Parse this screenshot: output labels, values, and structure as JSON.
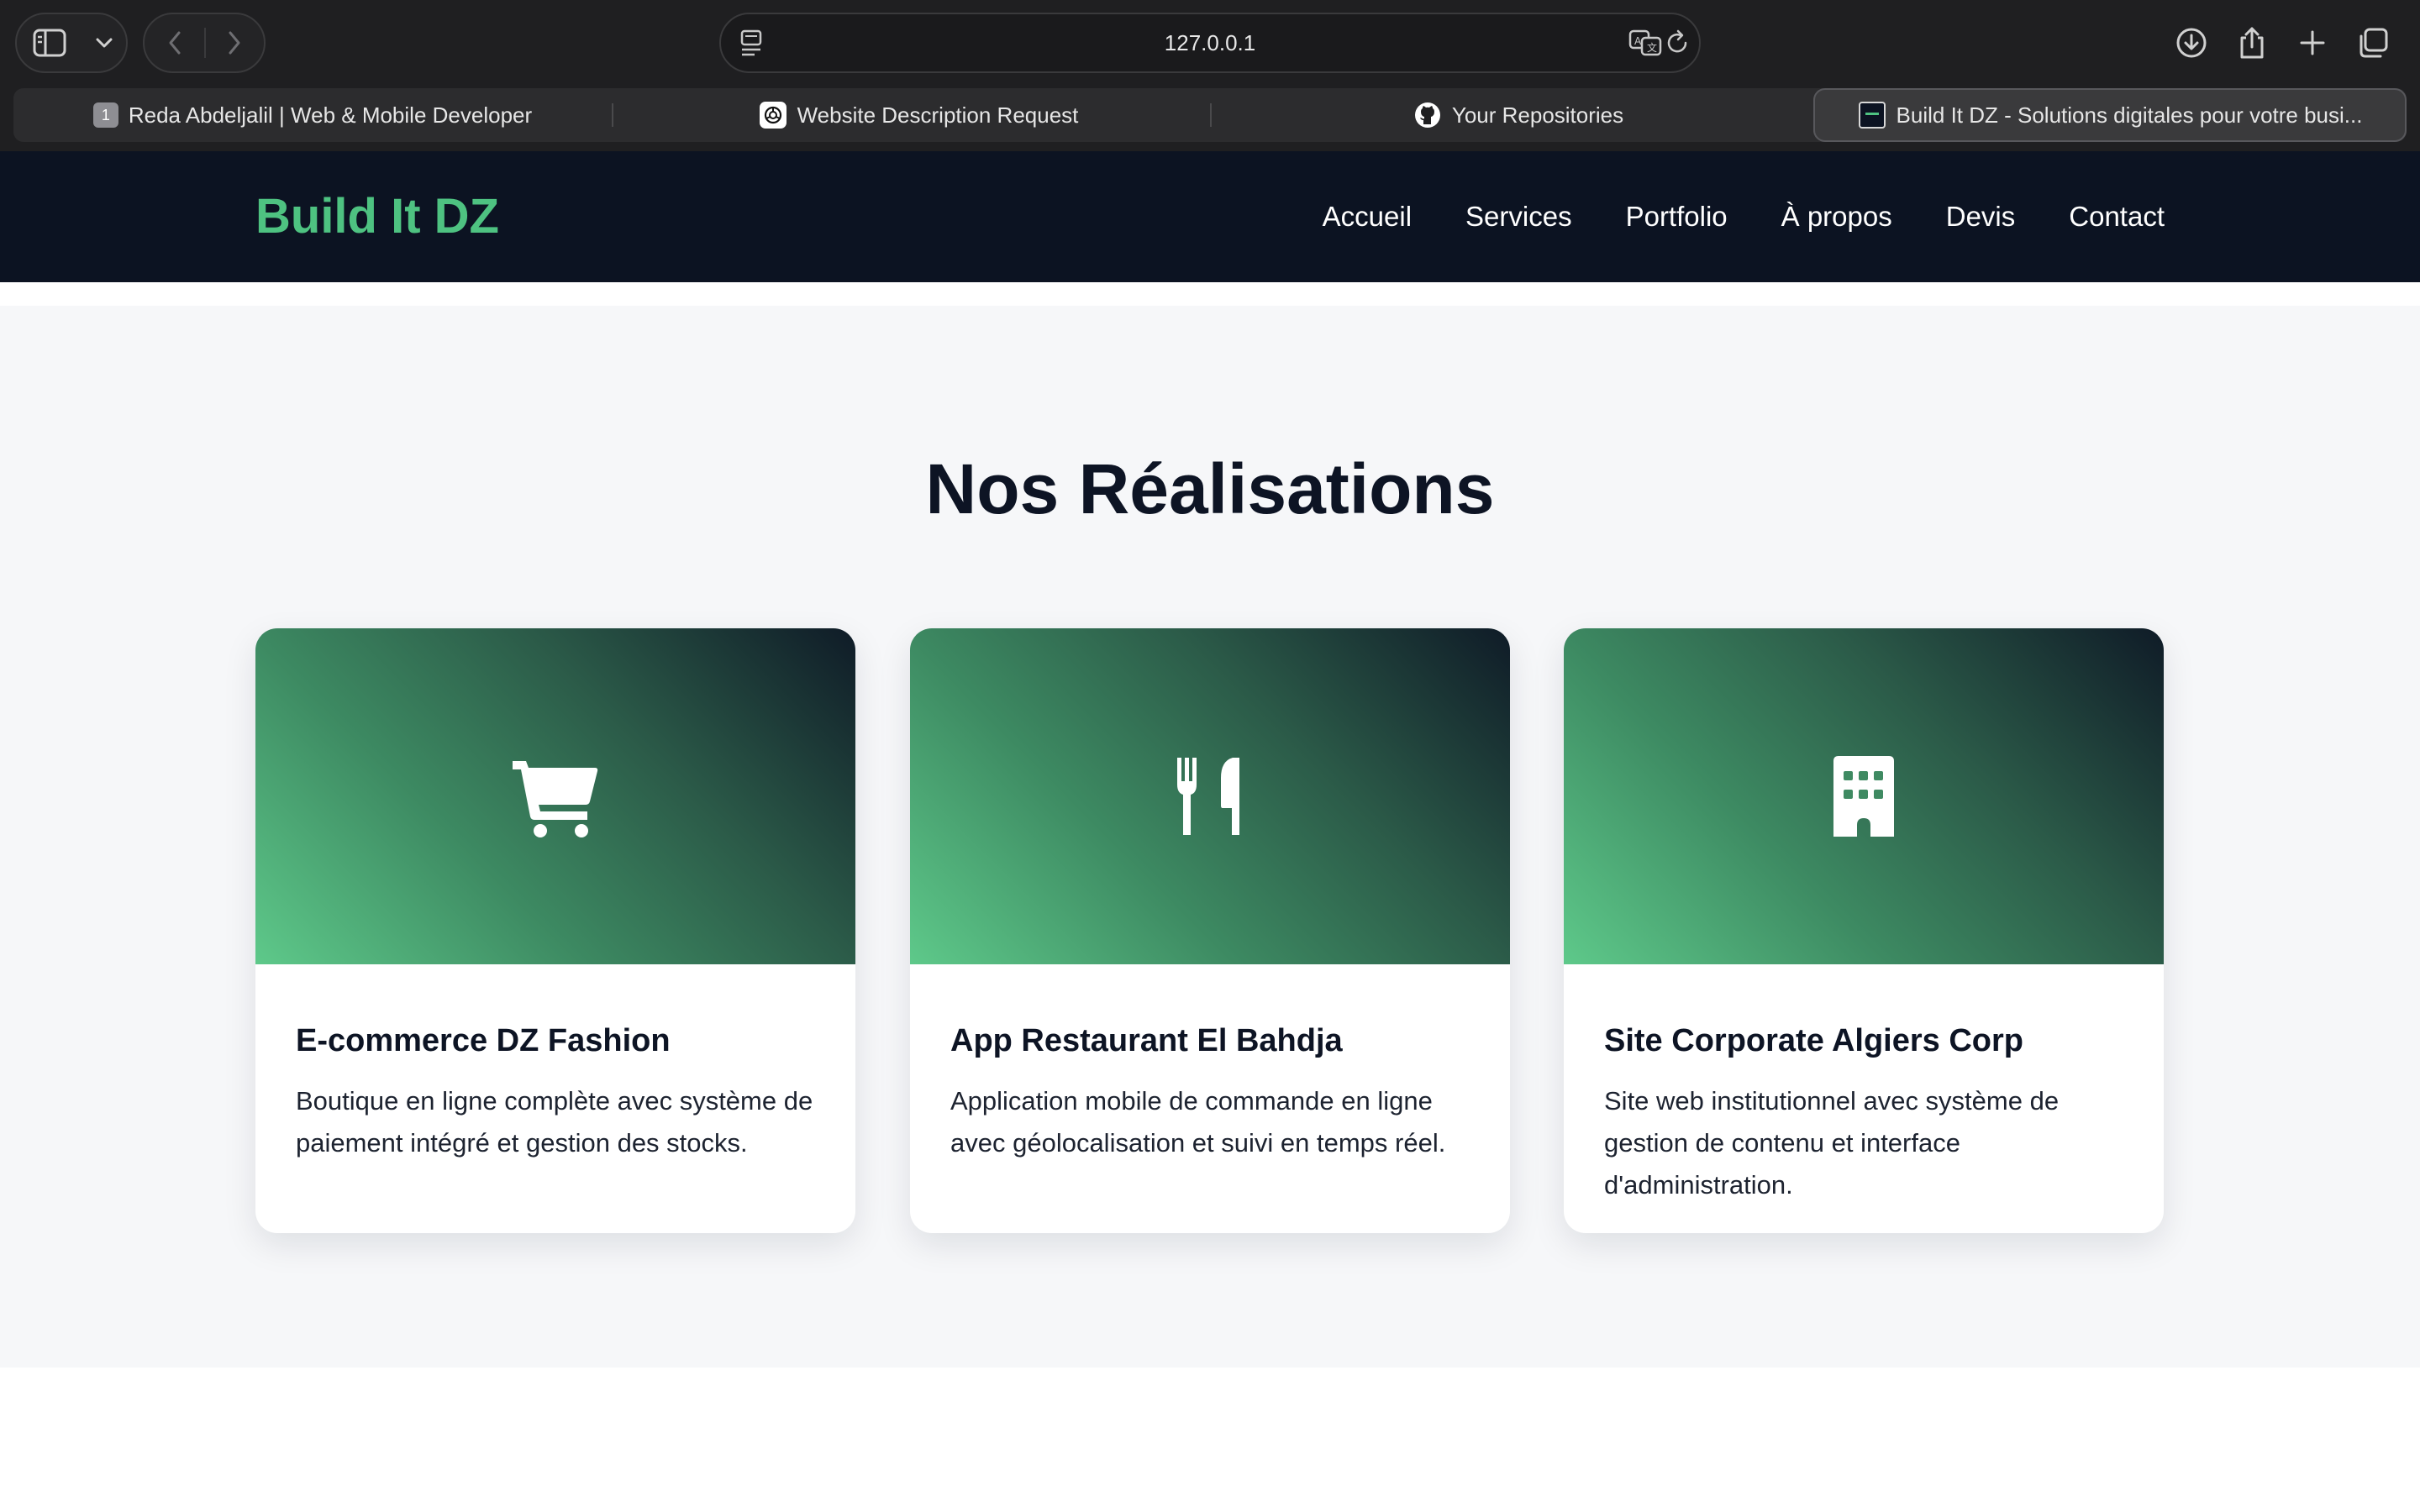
{
  "browser": {
    "url": "127.0.0.1",
    "tabs": [
      {
        "label": "Reda Abdeljalil | Web & Mobile Developer",
        "badge": "1"
      },
      {
        "label": "Website Description Request"
      },
      {
        "label": "Your Repositories"
      },
      {
        "label": "Build It DZ - Solutions digitales pour votre busi..."
      }
    ],
    "active_tab_index": 3
  },
  "site": {
    "logo": "Build It DZ",
    "nav": [
      "Accueil",
      "Services",
      "Portfolio",
      "À propos",
      "Devis",
      "Contact"
    ],
    "accent_color": "#4ec281",
    "header_color": "#0c1322"
  },
  "portfolio": {
    "title": "Nos Réalisations",
    "cards": [
      {
        "icon": "shopping-cart-icon",
        "title": "E-commerce DZ Fashion",
        "description": "Boutique en ligne complète avec système de paiement intégré et gestion des stocks."
      },
      {
        "icon": "utensils-icon",
        "title": "App Restaurant El Bahdja",
        "description": "Application mobile de commande en ligne avec géolocalisation et suivi en temps réel."
      },
      {
        "icon": "building-icon",
        "title": "Site Corporate Algiers Corp",
        "description": "Site web institutionnel avec système de gestion de contenu et interface d'administration."
      }
    ]
  }
}
